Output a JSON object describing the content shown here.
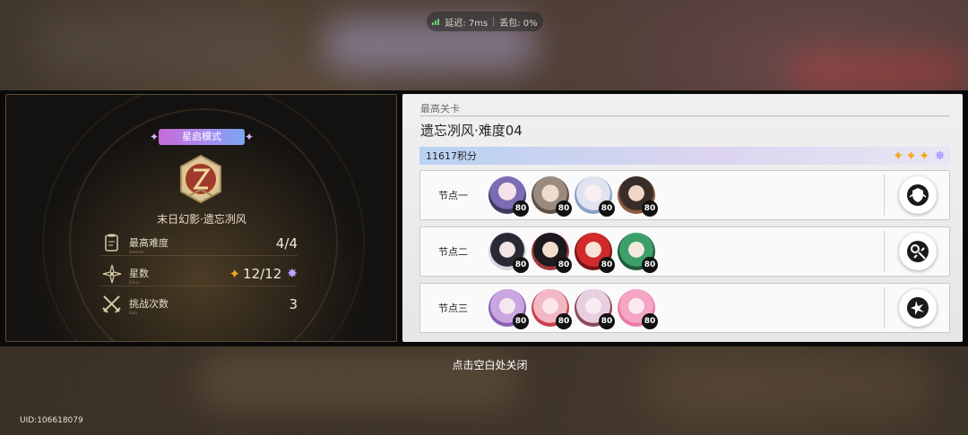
{
  "network": {
    "latency": "延迟: 7ms",
    "packet_loss": "丢包: 0%"
  },
  "summary": {
    "mode_badge": "星启模式",
    "stage_name": "末日幻影·遗忘冽风",
    "stats": [
      {
        "label": "最高难度",
        "sub": "Sesstion",
        "value": "4/4",
        "icon": "clipboard-icon"
      },
      {
        "label": "星数",
        "sub": "Emny",
        "value": "12/12",
        "icon": "compass-star-icon"
      },
      {
        "label": "挑战次数",
        "sub": "Easy",
        "value": "3",
        "icon": "crossed-swords-icon"
      }
    ]
  },
  "detail": {
    "caption": "最高关卡",
    "title": "遗忘冽风·难度04",
    "score": "11617积分",
    "stars_earned": 3,
    "nodes": [
      {
        "label": "节点一",
        "levels": [
          "80",
          "80",
          "80",
          "80"
        ],
        "action_icon": "shield-ribbon-icon"
      },
      {
        "label": "节点二",
        "levels": [
          "80",
          "80",
          "80",
          "80"
        ],
        "action_icon": "crosshair-target-icon"
      },
      {
        "label": "节点三",
        "levels": [
          "80",
          "80",
          "80",
          "80"
        ],
        "action_icon": "star-burst-icon"
      }
    ]
  },
  "close_hint": "点击空白处关闭",
  "uid": "UID:106618079",
  "colors": {
    "gold": "#f3a623",
    "badge_gradient": [
      "#c86bd8",
      "#7aa6f2"
    ],
    "score_bar": [
      "#b8d2f2",
      "#e6e6f3"
    ]
  }
}
